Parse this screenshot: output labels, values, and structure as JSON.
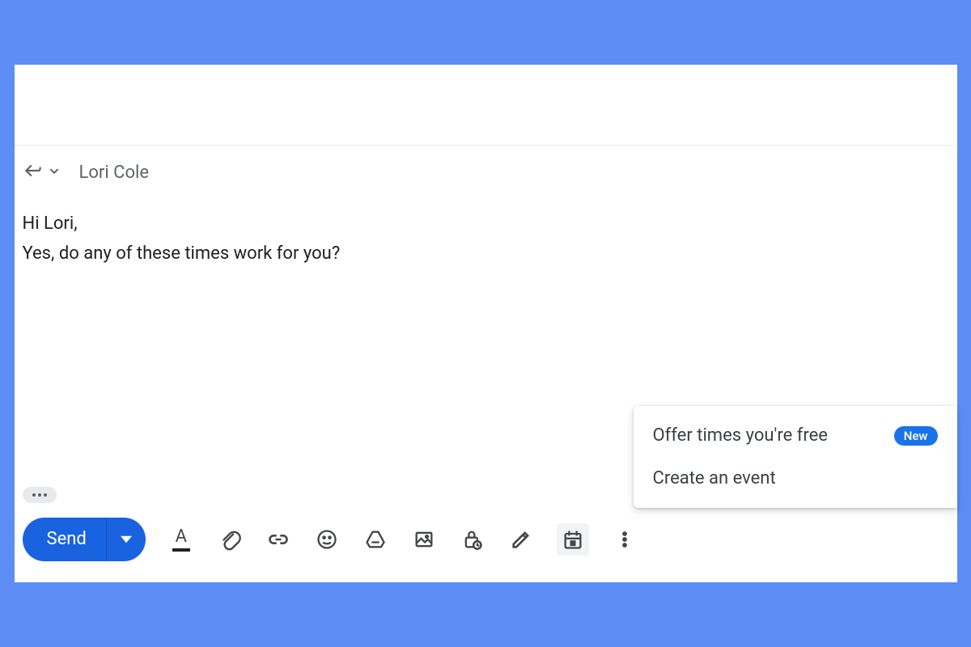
{
  "recipient": {
    "name": "Lori Cole"
  },
  "body": {
    "line1": "Hi Lori,",
    "line2": "Yes, do any of these times work for you?"
  },
  "toolbar": {
    "send_label": "Send",
    "format_letter": "A"
  },
  "popup": {
    "offer_times": "Offer times you're free",
    "create_event": "Create an event",
    "new_badge": "New"
  },
  "colors": {
    "accent_blue": "#1a63e0",
    "badge_blue": "#1a73e8",
    "text_primary": "#202124",
    "text_secondary": "#5f6368"
  }
}
